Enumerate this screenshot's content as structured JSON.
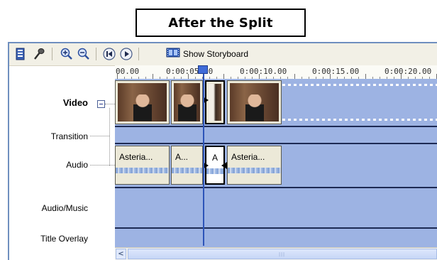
{
  "caption": "After the Split",
  "toolbar": {
    "buttons": [
      {
        "icon": "storyboard-tree-icon"
      },
      {
        "icon": "audio-levels-icon"
      },
      {
        "icon": "zoom-in-icon"
      },
      {
        "icon": "zoom-out-icon"
      },
      {
        "icon": "rewind-icon"
      },
      {
        "icon": "play-icon"
      }
    ],
    "show_storyboard_label": "Show Storyboard"
  },
  "ruler": {
    "ticks": [
      "00.00",
      "0:00:05.00",
      "0:00:10.00",
      "0:00:15.00",
      "0:00:20.00"
    ]
  },
  "tracks": {
    "video": "Video",
    "transition": "Transition",
    "audio": "Audio",
    "audio_music": "Audio/Music",
    "title_overlay": "Title Overlay"
  },
  "audio_clips": [
    {
      "label": "Asteria..."
    },
    {
      "label": "A..."
    },
    {
      "label": "A"
    },
    {
      "label": "Asteria..."
    }
  ],
  "colors": {
    "track_blue": "#9db3e3",
    "playhead": "#2d54b8"
  }
}
